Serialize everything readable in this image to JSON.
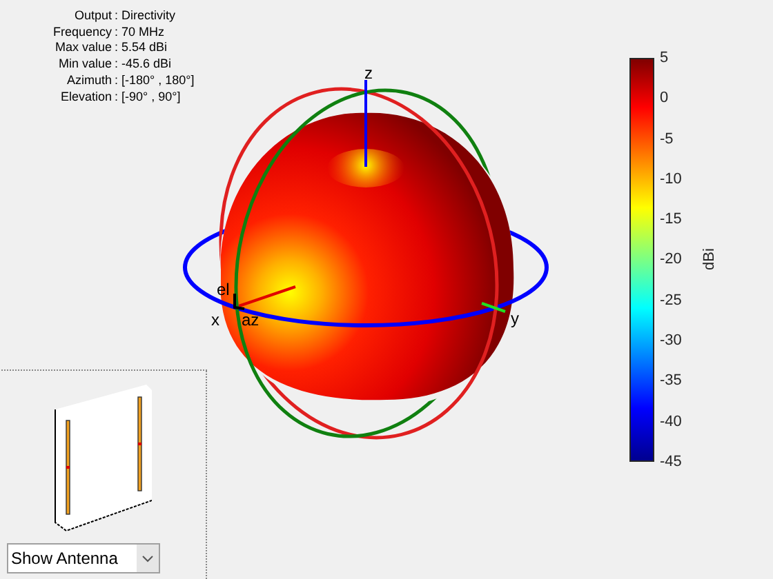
{
  "info": [
    {
      "label": "Output",
      "value": ": Directivity"
    },
    {
      "label": "Frequency",
      "value": ": 70 MHz"
    },
    {
      "label": "Max value",
      "value": ": 5.54 dBi"
    },
    {
      "label": "Min value",
      "value": ": -45.6 dBi"
    },
    {
      "label": "Azimuth",
      "value": ": [-180° , 180°]"
    },
    {
      "label": "Elevation",
      "value": ": [-90° , 90°]"
    }
  ],
  "plot": {
    "axis_labels": {
      "z": "z",
      "x": "x",
      "y": "y"
    },
    "marker_labels": {
      "elevation": "el",
      "azimuth": "az"
    }
  },
  "colorbar": {
    "ticks": [
      "5",
      "0",
      "-5",
      "-10",
      "-15",
      "-20",
      "-25",
      "-30",
      "-35",
      "-40",
      "-45"
    ],
    "unit": "dBi"
  },
  "antenna_panel": {
    "dropdown": {
      "value": "Show Antenna"
    }
  }
}
